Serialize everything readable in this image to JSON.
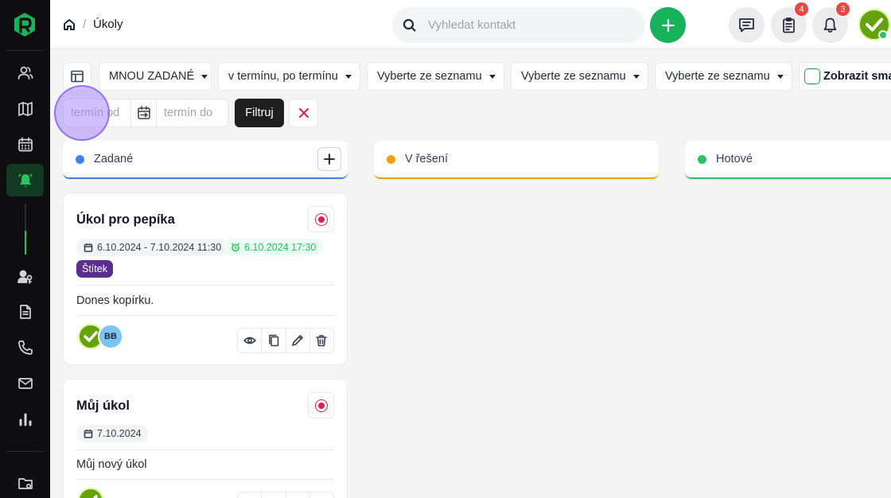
{
  "breadcrumb": {
    "page": "Úkoly"
  },
  "search": {
    "placeholder": "Vyhledat kontakt"
  },
  "notifications": {
    "tasks_count": "4",
    "alerts_count": "3"
  },
  "filters": {
    "assigned": "MNOU ZADANÉ",
    "deadline": "v termínu, po termínu",
    "select1": "Vyberte ze seznamu",
    "select2": "Vyberte ze seznamu",
    "select3": "Vyberte ze seznamu",
    "show_deleted": "Zobrazit smazané",
    "date_from_placeholder": "termín od",
    "date_to_placeholder": "termín do",
    "apply": "Filtruj"
  },
  "columns": [
    {
      "title": "Zadané",
      "color": "#3b82f6"
    },
    {
      "title": "V řešení",
      "color": "#f59e0b"
    },
    {
      "title": "Hotové",
      "color": "#22c55e"
    }
  ],
  "tasks": [
    {
      "title": "Úkol pro pepíka",
      "date_range": "6.10.2024 - 7.10.2024 11:30",
      "reminder": "6.10.2024 17:30",
      "tag": "Štítek",
      "description": "Dones kopírku.",
      "assignee_initials": "BB"
    },
    {
      "title": "Můj úkol",
      "date": "7.10.2024",
      "description": "Můj nový úkol"
    }
  ],
  "colors": {
    "brand": "#16b35a",
    "sidebar": "#0e0e10",
    "alert": "#e11d48",
    "tag": "#5b2d91"
  }
}
